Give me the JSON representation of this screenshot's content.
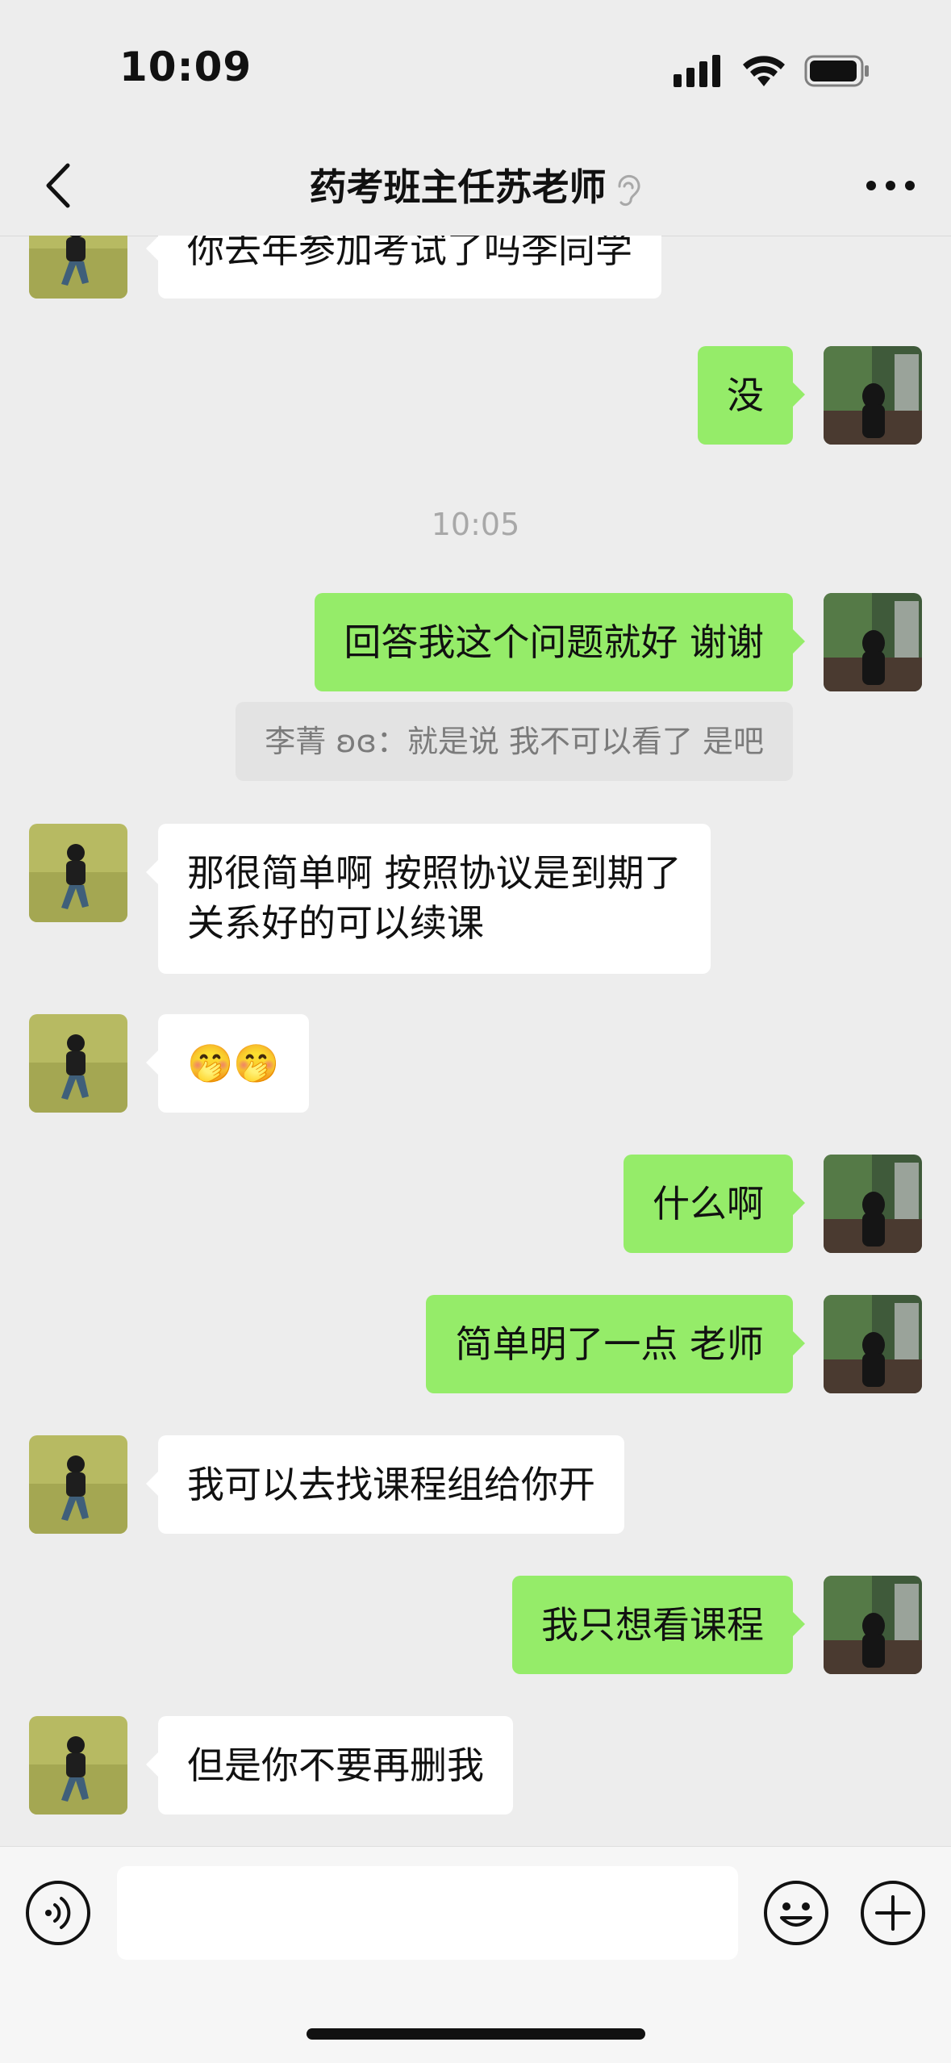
{
  "status_bar": {
    "time": "10:09"
  },
  "nav": {
    "title": "药考班主任苏老师"
  },
  "messages": [
    {
      "side": "in",
      "text": "你去年参加考试了吗李同学"
    },
    {
      "side": "out",
      "text": "没"
    },
    {
      "timestamp": "10:05"
    },
    {
      "side": "out",
      "text": "回答我这个问题就好 谢谢"
    },
    {
      "quote": "李菁 ʚɞ：就是说 我不可以看了 是吧"
    },
    {
      "side": "in",
      "text": "那很简单啊 按照协议是到期了\n关系好的可以续课"
    },
    {
      "side": "in",
      "text": "🤭🤭"
    },
    {
      "side": "out",
      "text": "什么啊"
    },
    {
      "side": "out",
      "text": "简单明了一点 老师"
    },
    {
      "side": "in",
      "text": "我可以去找课程组给你开"
    },
    {
      "side": "out",
      "text": "我只想看课程"
    },
    {
      "side": "in",
      "text": "但是你不要再删我"
    }
  ],
  "colors": {
    "bubble_out": "#95ec69",
    "bubble_in": "#ffffff",
    "background": "#ededed"
  },
  "icons": {
    "back": "chevron-left-icon",
    "ear": "ear-icon",
    "more": "more-dots-icon",
    "voice": "voice-icon",
    "emoji": "emoji-icon",
    "plus": "plus-icon"
  }
}
